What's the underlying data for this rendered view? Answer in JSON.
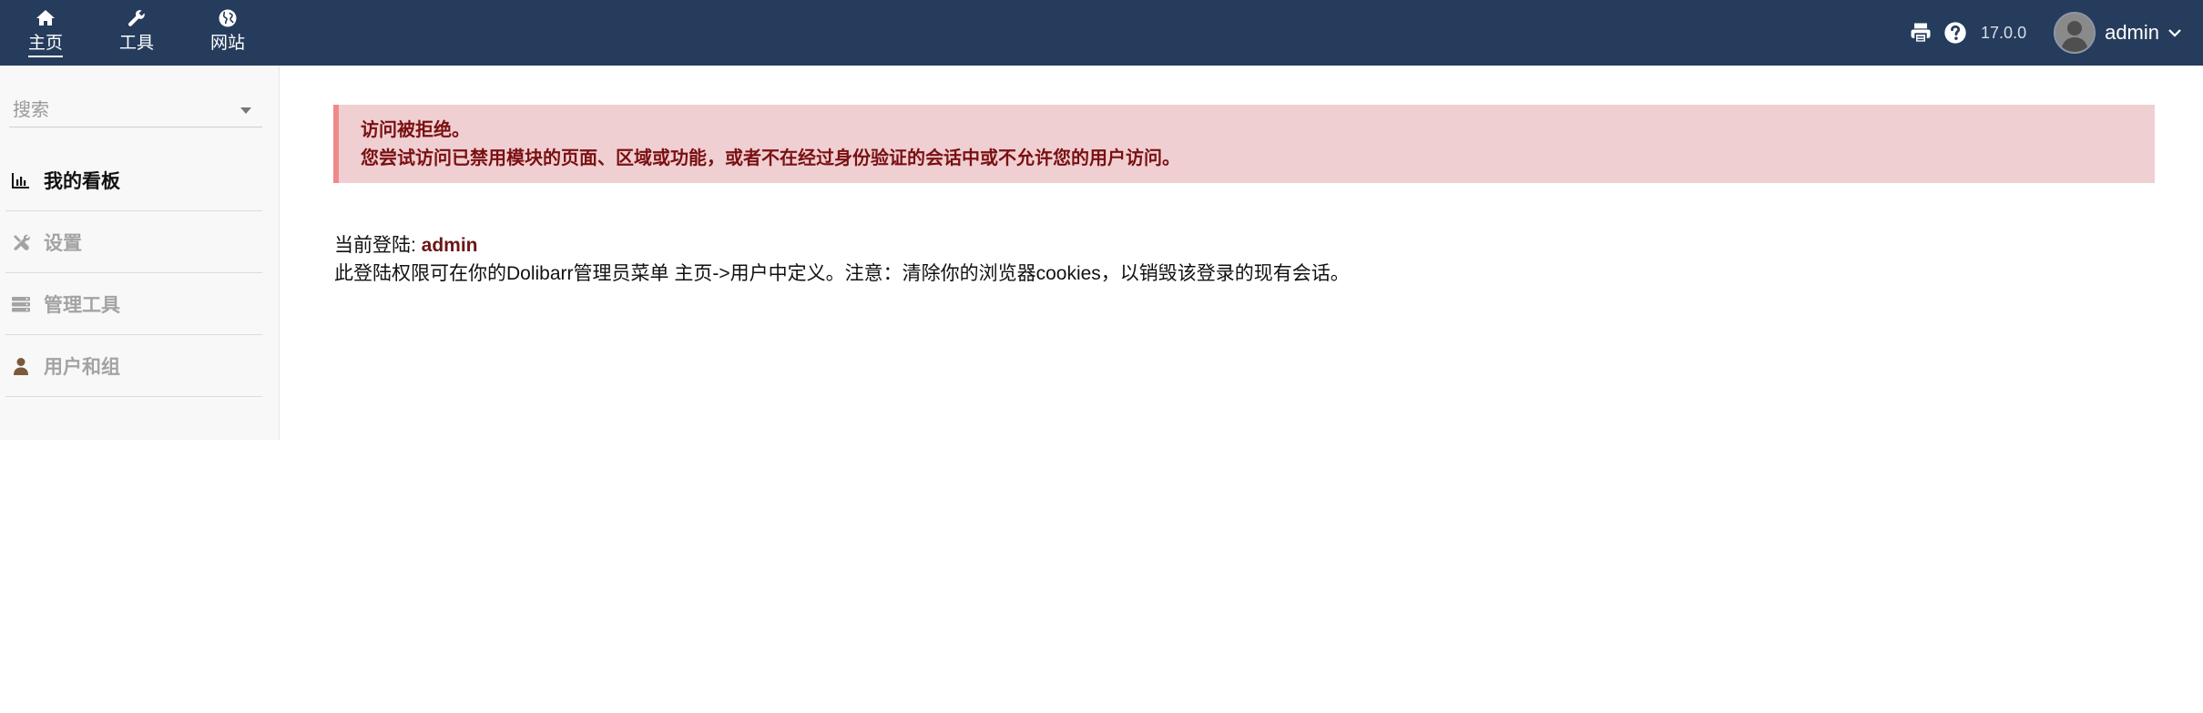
{
  "topnav": {
    "items": [
      {
        "label": "主页",
        "icon": "home-icon"
      },
      {
        "label": "工具",
        "icon": "wrench-icon"
      },
      {
        "label": "网站",
        "icon": "globe-icon"
      }
    ],
    "version": "17.0.0",
    "username": "admin"
  },
  "sidebar": {
    "search_placeholder": "搜索",
    "items": [
      {
        "label": "我的看板",
        "icon": "chart-icon"
      },
      {
        "label": "设置",
        "icon": "tools-icon"
      },
      {
        "label": "管理工具",
        "icon": "server-icon"
      },
      {
        "label": "用户和组",
        "icon": "user-icon"
      }
    ]
  },
  "alert": {
    "line1": "访问被拒绝。",
    "line2": "您尝试访问已禁用模块的页面、区域或功能，或者不在经过身份验证的会话中或不允许您的用户访问。"
  },
  "info": {
    "current_login_label": "当前登陆: ",
    "current_login_user": "admin",
    "note": "此登陆权限可在你的Dolibarr管理员菜单 主页->用户中定义。注意：清除你的浏览器cookies，以销毁该登录的现有会话。"
  },
  "colors": {
    "topbar": "#263c5c",
    "alert_bg": "#f0cfd2",
    "alert_text": "#7a1012",
    "alert_border": "#f08a8a"
  }
}
